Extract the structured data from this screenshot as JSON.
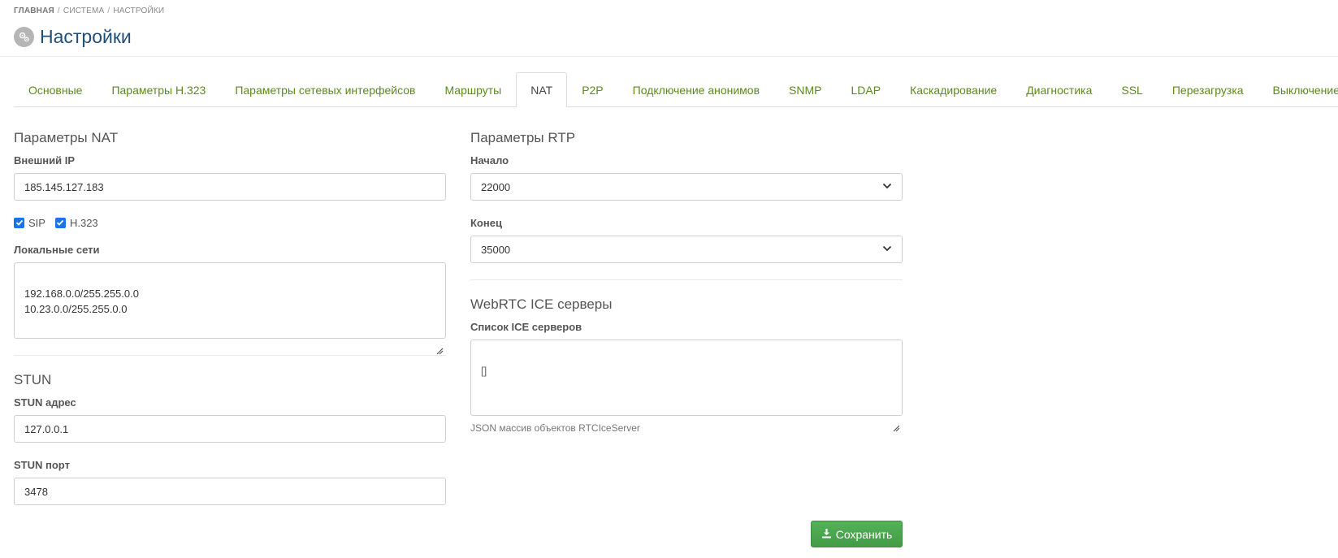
{
  "breadcrumb": {
    "first": "ГЛАВНАЯ",
    "second": "СИСТЕМА",
    "third": "НАСТРОЙКИ",
    "sep": "/"
  },
  "page": {
    "title": "Настройки"
  },
  "tabs": [
    {
      "label": "Основные"
    },
    {
      "label": "Параметры H.323"
    },
    {
      "label": "Параметры сетевых интерфейсов"
    },
    {
      "label": "Маршруты"
    },
    {
      "label": "NAT",
      "active": true
    },
    {
      "label": "P2P"
    },
    {
      "label": "Подключение анонимов"
    },
    {
      "label": "SNMP"
    },
    {
      "label": "LDAP"
    },
    {
      "label": "Каскадирование"
    },
    {
      "label": "Диагностика"
    },
    {
      "label": "SSL"
    },
    {
      "label": "Перезагрузка"
    },
    {
      "label": "Выключение"
    }
  ],
  "nat": {
    "section_title": "Параметры NAT",
    "external_ip_label": "Внешний IP",
    "external_ip_value": "185.145.127.183",
    "sip_label": "SIP",
    "h323_label": "H.323",
    "local_nets_label": "Локальные сети",
    "local_nets_value": "192.168.0.0/255.255.0.0\n10.23.0.0/255.255.0.0"
  },
  "stun": {
    "section_title": "STUN",
    "address_label": "STUN адрес",
    "address_value": "127.0.0.1",
    "port_label": "STUN порт",
    "port_value": "3478"
  },
  "rtp": {
    "section_title": "Параметры RTP",
    "start_label": "Начало",
    "start_value": "22000",
    "end_label": "Конец",
    "end_value": "35000"
  },
  "webrtc": {
    "section_title": "WebRTC ICE серверы",
    "ice_label": "Список ICE серверов",
    "ice_value": "[]",
    "help": "JSON массив объектов RTCIceServer"
  },
  "actions": {
    "save_label": "Сохранить"
  },
  "colors": {
    "accent_green": "#5c8a1e",
    "title_blue": "#1f4e79",
    "save_green": "#4caf50",
    "checkbox_blue": "#1a73e8"
  }
}
